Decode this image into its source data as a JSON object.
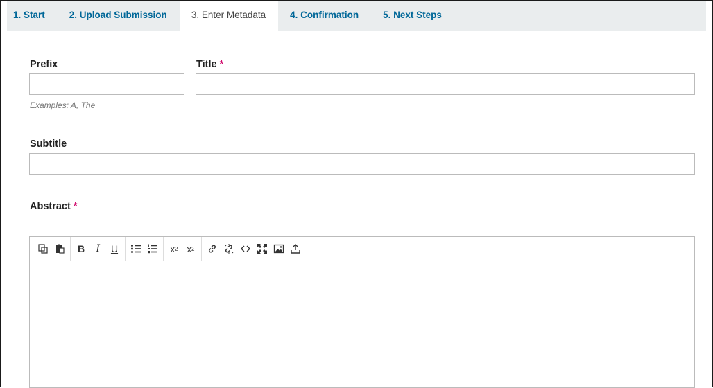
{
  "tabs": [
    {
      "label": "1. Start"
    },
    {
      "label": "2. Upload Submission"
    },
    {
      "label": "3. Enter Metadata"
    },
    {
      "label": "4. Confirmation"
    },
    {
      "label": "5. Next Steps"
    }
  ],
  "active_tab": 2,
  "form": {
    "prefix": {
      "label": "Prefix",
      "value": "",
      "hint": "Examples: A, The"
    },
    "title": {
      "label": "Title",
      "required_mark": "*",
      "value": ""
    },
    "subtitle": {
      "label": "Subtitle",
      "value": ""
    },
    "abstract": {
      "label": "Abstract",
      "required_mark": "*",
      "value": ""
    }
  },
  "toolbar": {
    "icons": [
      "copy-icon",
      "paste-icon",
      "bold-icon",
      "italic-icon",
      "underline-icon",
      "bullet-list-icon",
      "numbered-list-icon",
      "superscript-icon",
      "subscript-icon",
      "link-icon",
      "unlink-icon",
      "code-icon",
      "fullscreen-icon",
      "image-icon",
      "upload-icon"
    ]
  },
  "colors": {
    "tab_link": "#006798",
    "tab_bar": "#eaedee",
    "required": "#d00a6c"
  }
}
